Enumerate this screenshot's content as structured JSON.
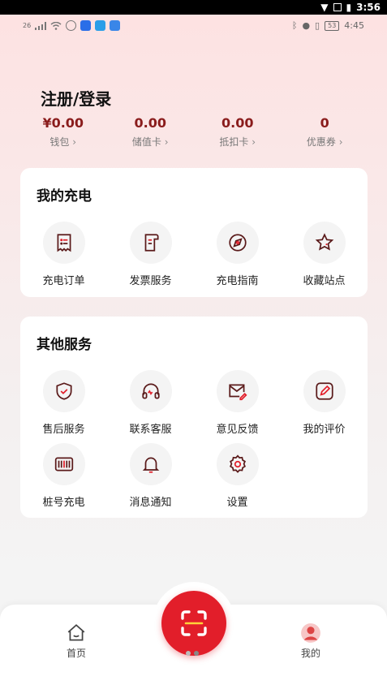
{
  "system_bar": {
    "time": "3:56"
  },
  "status_bar": {
    "network": "26",
    "battery": "53",
    "time": "4:45"
  },
  "account": {
    "login_label": "注册/登录"
  },
  "stats": [
    {
      "value": "¥0.00",
      "label": "钱包"
    },
    {
      "value": "0.00",
      "label": "储值卡"
    },
    {
      "value": "0.00",
      "label": "抵扣卡"
    },
    {
      "value": "0",
      "label": "优惠券"
    }
  ],
  "my_charging": {
    "title": "我的充电",
    "items": [
      {
        "label": "充电订单",
        "icon": "receipt-icon"
      },
      {
        "label": "发票服务",
        "icon": "invoice-icon"
      },
      {
        "label": "充电指南",
        "icon": "compass-icon"
      },
      {
        "label": "收藏站点",
        "icon": "star-icon"
      }
    ]
  },
  "other_services": {
    "title": "其他服务",
    "items": [
      {
        "label": "售后服务",
        "icon": "shield-check-icon"
      },
      {
        "label": "联系客服",
        "icon": "headset-icon"
      },
      {
        "label": "意见反馈",
        "icon": "feedback-mail-icon"
      },
      {
        "label": "我的评价",
        "icon": "edit-icon"
      },
      {
        "label": "桩号充电",
        "icon": "barcode-icon"
      },
      {
        "label": "消息通知",
        "icon": "bell-icon"
      },
      {
        "label": "设置",
        "icon": "gear-icon"
      }
    ]
  },
  "tabbar": {
    "home_label": "首页",
    "mine_label": "我的"
  },
  "colors": {
    "accent": "#e21e2a",
    "value_text": "#8a1c1c",
    "icon_stroke": "#5a1a1a"
  }
}
